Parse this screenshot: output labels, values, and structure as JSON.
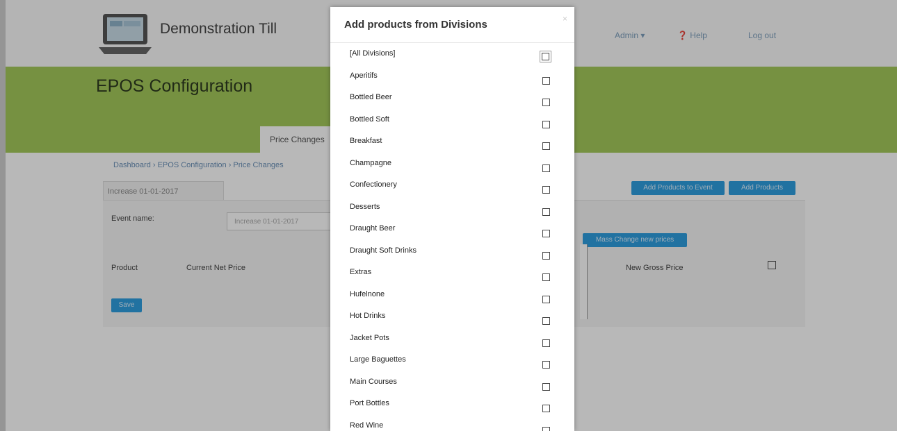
{
  "header": {
    "app_name": "Demonstration Till",
    "nav": [
      "Admin ▾",
      "Help",
      "Log out"
    ]
  },
  "page": {
    "title": "EPOS Configuration",
    "active_tab": "Price Changes",
    "breadcrumb": "Dashboard › EPOS Configuration › Price Changes"
  },
  "editor": {
    "event_tab": "Increase 01-01-2017",
    "event_name_label": "Event name:",
    "event_name_value": "Increase 01-01-2017",
    "add_products_to_event": "Add Products to Event",
    "add_products": "Add Products",
    "mass_change": "Mass Change new prices",
    "columns": [
      "Product",
      "Current Net Price",
      "New Gross Price"
    ],
    "save": "Save"
  },
  "modal": {
    "title": "Add products from Divisions",
    "close": "×",
    "divisions": [
      "[All Divisions]",
      "Aperitifs",
      "Bottled Beer",
      "Bottled Soft",
      "Breakfast",
      "Champagne",
      "Confectionery",
      "Desserts",
      "Draught Beer",
      "Draught Soft Drinks",
      "Extras",
      "Hufelnone",
      "Hot Drinks",
      "Jacket Pots",
      "Large Baguettes",
      "Main Courses",
      "Port Bottles",
      "Red Wine"
    ]
  }
}
